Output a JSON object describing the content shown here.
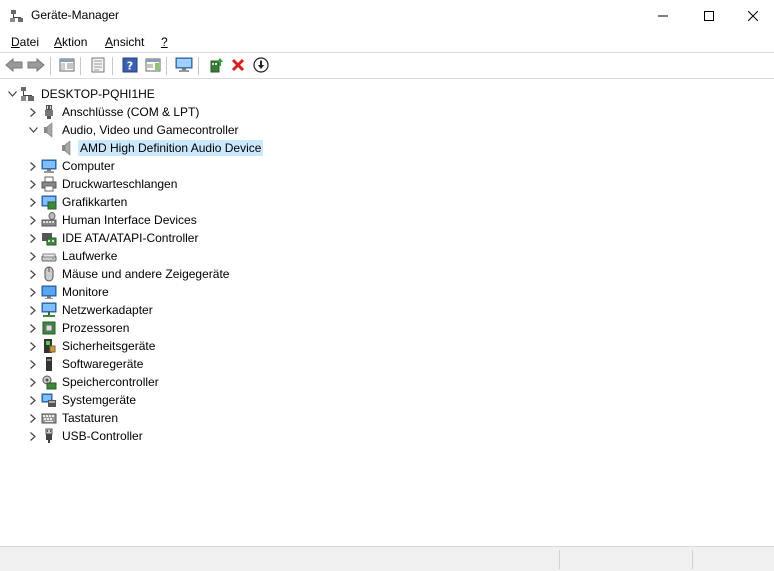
{
  "window": {
    "title": "Geräte-Manager",
    "icon": "device-manager-icon"
  },
  "menu": [
    {
      "label": "Datei",
      "accel": "D",
      "rest": "atei"
    },
    {
      "label": "Aktion",
      "accel": "A",
      "rest": "ktion"
    },
    {
      "label": "Ansicht",
      "accel": "A",
      "rest": "nsicht"
    },
    {
      "label": "?",
      "accel": "?",
      "rest": ""
    }
  ],
  "toolbar": [
    "back-icon",
    "forward-icon",
    "show-hide-console-tree-icon",
    "properties-icon",
    "help-icon",
    "action-pane-icon",
    "scan-hardware-icon",
    "update-driver-icon",
    "uninstall-device-icon",
    "disable-device-icon"
  ],
  "tree": {
    "root": {
      "label": "DESKTOP-PQHI1HE",
      "expanded": true,
      "icon": "computer-tree-icon"
    },
    "categories": [
      {
        "label": "Anschlüsse (COM & LPT)",
        "expanded": false,
        "icon": "port-icon"
      },
      {
        "label": "Audio, Video und Gamecontroller",
        "expanded": true,
        "icon": "speaker-icon",
        "children": [
          {
            "label": "AMD High Definition Audio Device",
            "selected": true,
            "icon": "speaker-icon"
          }
        ]
      },
      {
        "label": "Computer",
        "expanded": false,
        "icon": "computer-icon"
      },
      {
        "label": "Druckwarteschlangen",
        "expanded": false,
        "icon": "printer-icon"
      },
      {
        "label": "Grafikkarten",
        "expanded": false,
        "icon": "display-adapter-icon"
      },
      {
        "label": "Human Interface Devices",
        "expanded": false,
        "icon": "hid-icon"
      },
      {
        "label": "IDE ATA/ATAPI-Controller",
        "expanded": false,
        "icon": "ide-controller-icon"
      },
      {
        "label": "Laufwerke",
        "expanded": false,
        "icon": "disk-drive-icon"
      },
      {
        "label": "Mäuse und andere Zeigegeräte",
        "expanded": false,
        "icon": "mouse-icon"
      },
      {
        "label": "Monitore",
        "expanded": false,
        "icon": "monitor-icon"
      },
      {
        "label": "Netzwerkadapter",
        "expanded": false,
        "icon": "network-adapter-icon"
      },
      {
        "label": "Prozessoren",
        "expanded": false,
        "icon": "processor-icon"
      },
      {
        "label": "Sicherheitsgeräte",
        "expanded": false,
        "icon": "security-device-icon"
      },
      {
        "label": "Softwaregeräte",
        "expanded": false,
        "icon": "software-device-icon"
      },
      {
        "label": "Speichercontroller",
        "expanded": false,
        "icon": "storage-controller-icon"
      },
      {
        "label": "Systemgeräte",
        "expanded": false,
        "icon": "system-device-icon"
      },
      {
        "label": "Tastaturen",
        "expanded": false,
        "icon": "keyboard-icon"
      },
      {
        "label": "USB-Controller",
        "expanded": false,
        "icon": "usb-icon"
      }
    ]
  }
}
